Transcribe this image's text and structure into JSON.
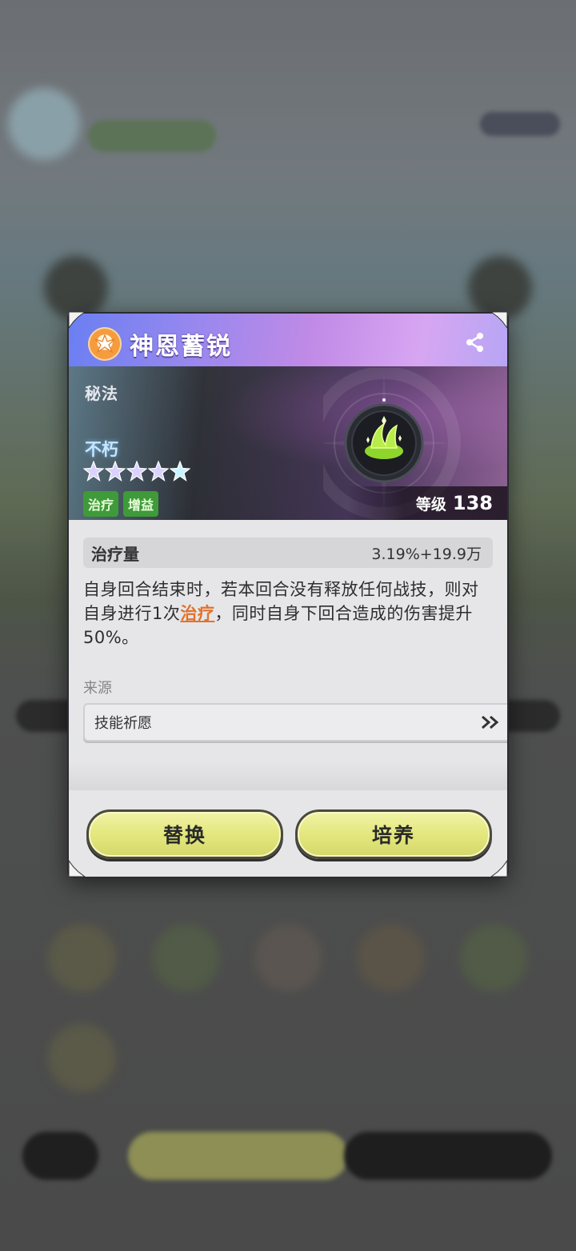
{
  "skill": {
    "name": "神恩蓄锐",
    "type": "秘法",
    "rarity": "不朽",
    "stars": 5,
    "tags": [
      "治疗",
      "增益"
    ],
    "level_label": "等级",
    "level_value": "138"
  },
  "stat": {
    "name": "治疗量",
    "value": "3.19%+19.9万"
  },
  "description": {
    "part1": "自身回合结束时，若本回合没有释放任何战技，则对自身进行1次",
    "link": "治疗",
    "part2": "，同时自身下回合造成的伤害提升50%。"
  },
  "source": {
    "label": "来源",
    "value": "技能祈愿"
  },
  "buttons": {
    "replace": "替换",
    "cultivate": "培养"
  },
  "colors": {
    "tag_green": "#3f9a3a",
    "link_orange": "#e2712b",
    "button_yellow": "#e3e77e"
  }
}
